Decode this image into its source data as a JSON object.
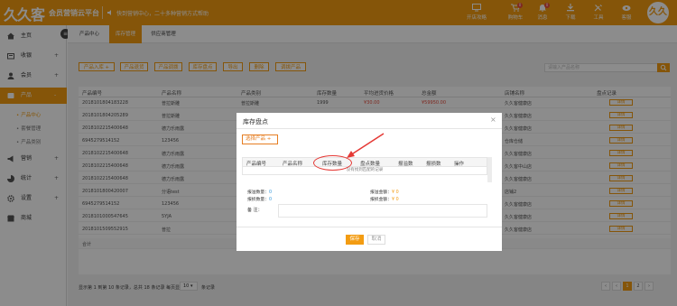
{
  "brand": {
    "logo": "久久客",
    "subtitle": "会员营销云平台"
  },
  "notice": "快到营销中心，二十多种营销方式帮助",
  "topbar": [
    {
      "label": "开店攻略",
      "icon": "monitor-icon"
    },
    {
      "label": "购物车",
      "icon": "cart-icon",
      "badge": "0"
    },
    {
      "label": "消息",
      "icon": "bell-icon",
      "badge": "0"
    },
    {
      "label": "下载",
      "icon": "download-icon"
    },
    {
      "label": "工具",
      "icon": "tools-icon"
    },
    {
      "label": "客服",
      "icon": "headset-icon"
    }
  ],
  "avatar": "久久",
  "sidebar": {
    "items": [
      {
        "label": "主页",
        "icon": "home-icon"
      },
      {
        "label": "收银",
        "icon": "cashier-icon",
        "expand": "+"
      },
      {
        "label": "会员",
        "icon": "member-icon",
        "expand": "+"
      },
      {
        "label": "产品",
        "icon": "product-icon",
        "expand": "-"
      },
      {
        "label": "营销",
        "icon": "marketing-icon",
        "expand": "+"
      },
      {
        "label": "统计",
        "icon": "stats-icon",
        "expand": "+"
      },
      {
        "label": "设置",
        "icon": "gear-icon",
        "expand": "+"
      },
      {
        "label": "商城",
        "icon": "mall-icon"
      }
    ],
    "sub": [
      "产品中心",
      "套餐管理",
      "产品类别"
    ],
    "toggle": "≡"
  },
  "tabs": [
    "产品中心",
    "库存管理",
    "供应商管理"
  ],
  "actions": [
    "产品入库 +",
    "产品退货",
    "产品调拨",
    "库存盘点",
    "导出",
    "删除",
    "调拨产品"
  ],
  "search_placeholder": "请输入产品名称",
  "table": {
    "headers": [
      "产品编号",
      "产品名称",
      "产品类别",
      "库存数量",
      "平均进货价格",
      "总金额",
      "店铺名称",
      "盘点记录"
    ],
    "rows": [
      [
        "2018101804183228",
        "普拉斯雕",
        "普拉斯雕",
        "1999",
        "¥30.00",
        "¥59950.00",
        "久久客健康店",
        "详情"
      ],
      [
        "2018101804205289",
        "普拉斯雕",
        "普拉斯雕",
        "",
        "",
        "",
        "久久客健康店",
        "详情"
      ],
      [
        "2018102215400648",
        "德力乐雨露",
        "德力乐雨露",
        "",
        "",
        "",
        "久久客健康店",
        "详情"
      ],
      [
        "6945279514152",
        "123456",
        "",
        "",
        "",
        "",
        "仓库仓储",
        "详情"
      ],
      [
        "2018102215400648",
        "德力乐雨露",
        "",
        "",
        "",
        "",
        "久久客健康店",
        "详情"
      ],
      [
        "2018102215400648",
        "德力乐雨露",
        "",
        "",
        "",
        "",
        "久久客中山店",
        "详情"
      ],
      [
        "2018102215400648",
        "德力乐雨露",
        "",
        "",
        "",
        "",
        "久久客健康店",
        "详情"
      ],
      [
        "2018101800420007",
        "分语test",
        "",
        "",
        "",
        "",
        "店铺2",
        "详情"
      ],
      [
        "6945279514152",
        "123456",
        "",
        "",
        "",
        "",
        "久久客健康店",
        "详情"
      ],
      [
        "2018101000547645",
        "5YJA",
        "",
        "",
        "",
        "",
        "久久客健康店",
        "详情"
      ],
      [
        "2018101509552915",
        "普拉",
        "",
        "",
        "",
        "",
        "久久客健康店",
        "详情"
      ]
    ],
    "footer_row": "合计"
  },
  "pager": {
    "info": "显示第 1 到第 10 条记录，总共 18 条记录 每页显示",
    "per_page": "10 ▾",
    "after": "条记录",
    "pages": [
      "‹",
      "1",
      "2",
      "›"
    ]
  },
  "modal": {
    "title": "库存盘点",
    "close": "×",
    "choose_btn": "选择产品 +",
    "headers": [
      "产品编号",
      "产品名称",
      "库存数量",
      "盘点数量",
      "报溢数",
      "报损数",
      "操作"
    ],
    "empty": "没有找到匹配的记录",
    "summary": [
      {
        "label": "报溢数量：",
        "value": "0"
      },
      {
        "label": "报溢金额：",
        "value": "¥ 0"
      },
      {
        "label": "报损数量：",
        "value": "0"
      },
      {
        "label": "报损金额：",
        "value": "¥ 0"
      }
    ],
    "remark_label": "备    注：",
    "save": "保存",
    "cancel": "取消"
  },
  "colors": {
    "accent": "#f39c12",
    "annotation": "#e53935"
  }
}
